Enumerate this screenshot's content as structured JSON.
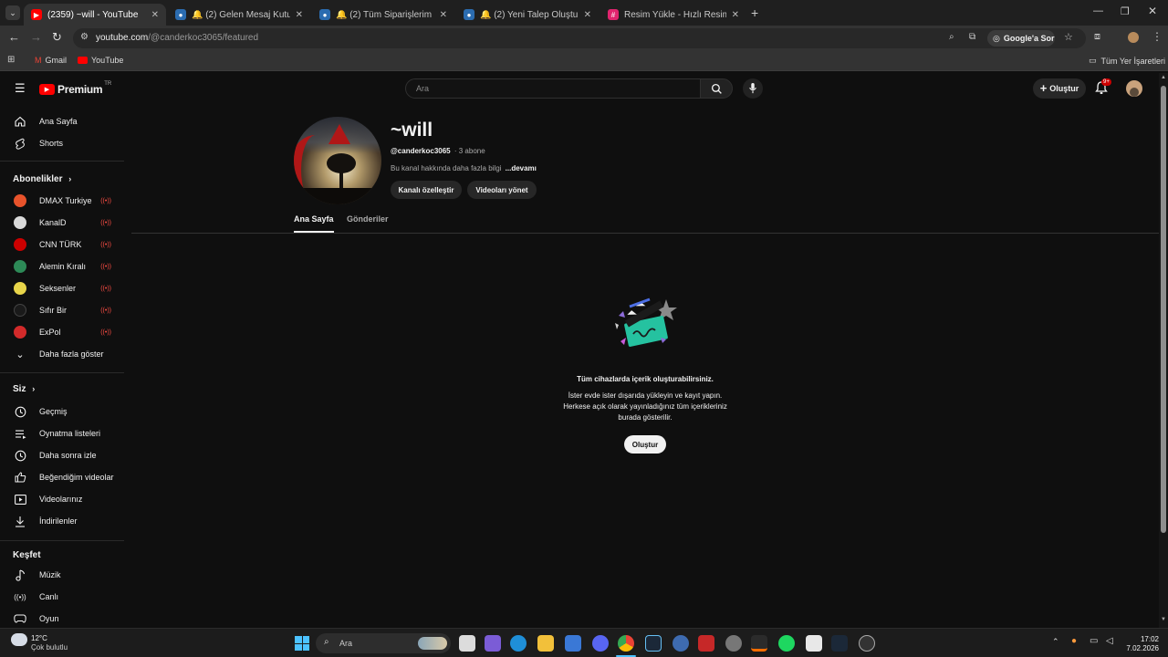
{
  "browser": {
    "tabs": [
      {
        "title": "(2359) ~will - YouTube",
        "active": true
      },
      {
        "title": "🔔 (2) Gelen Mesaj Kutusu ve S",
        "active": false
      },
      {
        "title": "🔔 (2) Tüm Siparişlerim - Sipar",
        "active": false
      },
      {
        "title": "🔔 (2) Yeni Talep Oluştur – İten",
        "active": false
      },
      {
        "title": "Resim Yükle - Hızlı Resim Payla",
        "active": false
      }
    ],
    "url_host": "youtube.com",
    "url_path": "/@canderkoc3065/featured",
    "google_lens_label": "Google'a Sor",
    "bookmarks": [
      "Gmail",
      "YouTube"
    ],
    "all_bookmarks_label": "Tüm Yer İşaretleri"
  },
  "youtube": {
    "logo_text": "Premium",
    "logo_region": "TR",
    "search_placeholder": "Ara",
    "create_label": "Oluştur",
    "notif_badge": "9+",
    "sidebar": {
      "main": [
        {
          "label": "Ana Sayfa",
          "icon": "home-icon"
        },
        {
          "label": "Shorts",
          "icon": "shorts-icon"
        }
      ],
      "subs_header": "Abonelikler",
      "subscriptions": [
        {
          "label": "DMAX Turkiye",
          "color": "#e8532b"
        },
        {
          "label": "KanalD",
          "color": "#d9d9d9"
        },
        {
          "label": "CNN TÜRK",
          "color": "#cc0000"
        },
        {
          "label": "Alemin Kıralı",
          "color": "#2d8a57"
        },
        {
          "label": "Seksenler",
          "color": "#e8d54a"
        },
        {
          "label": "Sıfır Bir",
          "color": "#1a1a1a"
        },
        {
          "label": "ExPol",
          "color": "#d22a2a"
        }
      ],
      "show_more": "Daha fazla göster",
      "you_header": "Siz",
      "you": [
        {
          "label": "Geçmiş",
          "icon": "history-icon"
        },
        {
          "label": "Oynatma listeleri",
          "icon": "playlist-icon"
        },
        {
          "label": "Daha sonra izle",
          "icon": "clock-icon"
        },
        {
          "label": "Beğendiğim videolar",
          "icon": "like-icon"
        },
        {
          "label": "Videolarınız",
          "icon": "video-icon"
        },
        {
          "label": "İndirilenler",
          "icon": "download-icon"
        }
      ],
      "explore_header": "Keşfet",
      "explore": [
        {
          "label": "Müzik",
          "icon": "music-icon"
        },
        {
          "label": "Canlı",
          "icon": "live-icon"
        },
        {
          "label": "Oyun",
          "icon": "gaming-icon"
        }
      ]
    },
    "channel": {
      "name": "~will",
      "handle": "@canderkoc3065",
      "subs": "· 3 abone",
      "about": "Bu kanal hakkında daha fazla bilgi",
      "more": "...devamı",
      "customize_label": "Kanalı özelleştir",
      "manage_label": "Videoları yönet",
      "tabs": [
        "Ana Sayfa",
        "Gönderiler"
      ]
    },
    "empty_state": {
      "heading": "Tüm cihazlarda içerik oluşturabilirsiniz.",
      "line1": "İster evde ister dışarıda yükleyin ve kayıt yapın.",
      "line2": "Herkese açık olarak yayınladığınız tüm içerikleriniz",
      "line3": "burada gösterilir.",
      "button": "Oluştur"
    }
  },
  "taskbar": {
    "weather_temp": "12°C",
    "weather_desc": "Çok bulutlu",
    "search_label": "Ara",
    "time": "17:02",
    "date": "7.02.2026"
  }
}
